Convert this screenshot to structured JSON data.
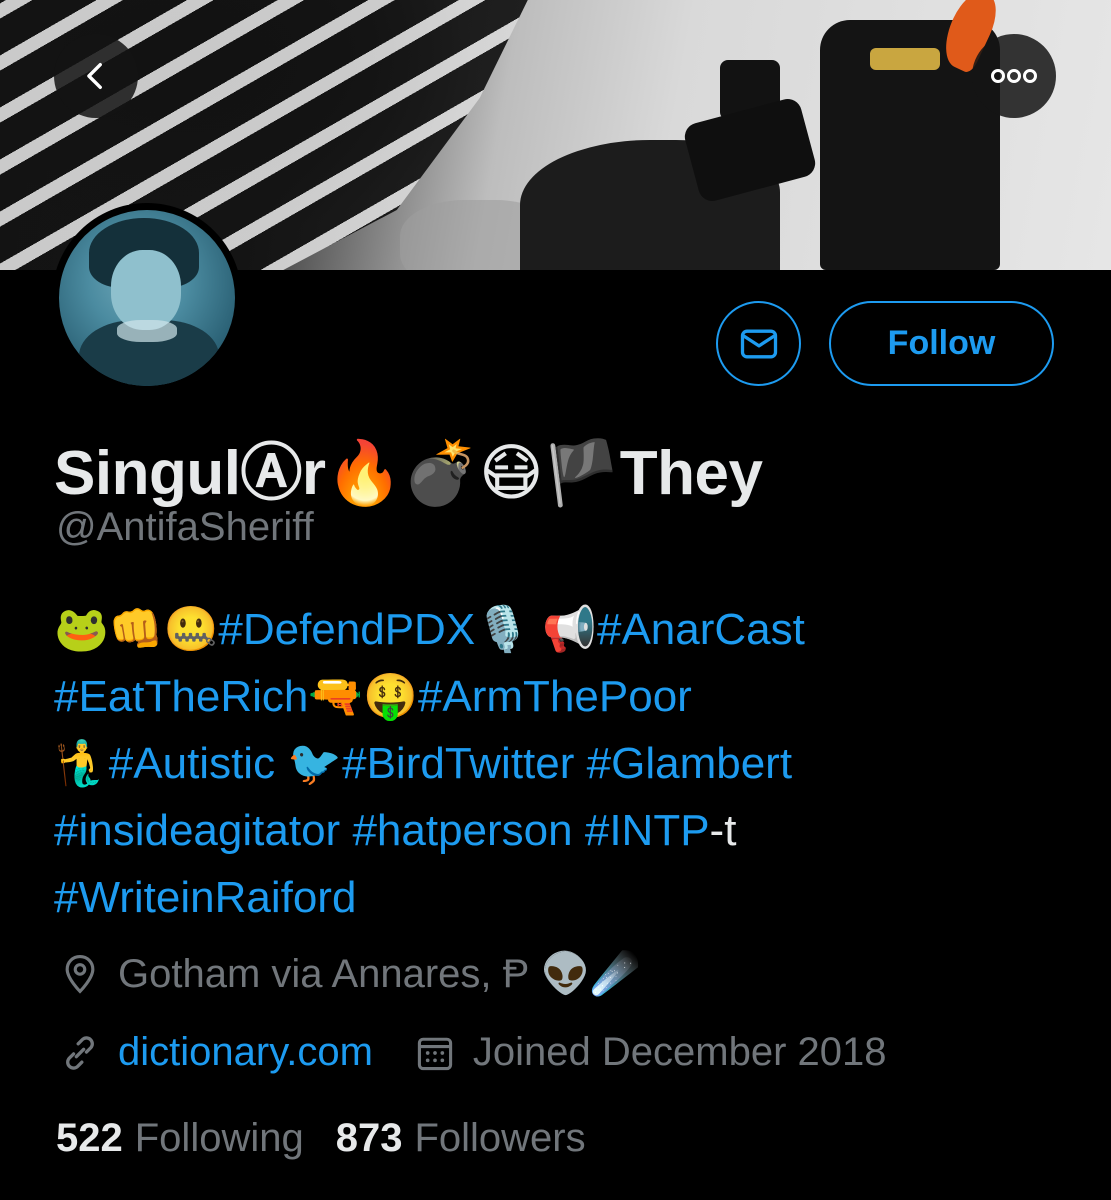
{
  "header": {
    "back_icon": "chevron-left-icon",
    "more_icon": "more-horizontal-icon"
  },
  "profile": {
    "display_name": "SingulⒶr🔥💣😷🏴They",
    "handle": "@AntifaSheriff",
    "follow_label": "Follow",
    "message_icon": "envelope-icon"
  },
  "bio": {
    "lines": [
      [
        {
          "t": "🐸👊🤐",
          "tag": false
        },
        {
          "t": "#DefendPDX",
          "tag": true
        },
        {
          "t": "🎙️ 📢",
          "tag": false
        },
        {
          "t": "#AnarCast",
          "tag": true
        }
      ],
      [
        {
          "t": "#EatTheRich",
          "tag": true
        },
        {
          "t": "🔫🤑",
          "tag": false
        },
        {
          "t": "#ArmThePoor",
          "tag": true
        }
      ],
      [
        {
          "t": "🧜‍♂️",
          "tag": false
        },
        {
          "t": "#Autistic",
          "tag": true
        },
        {
          "t": " 🐦",
          "tag": false
        },
        {
          "t": "#BirdTwitter",
          "tag": true
        },
        {
          "t": " ",
          "tag": false
        },
        {
          "t": "#Glambert",
          "tag": true
        }
      ],
      [
        {
          "t": "#insideagitator",
          "tag": true
        },
        {
          "t": " ",
          "tag": false
        },
        {
          "t": "#hatperson",
          "tag": true
        },
        {
          "t": " ",
          "tag": false
        },
        {
          "t": "#INTP",
          "tag": true
        },
        {
          "t": "-t",
          "tag": false
        }
      ],
      [
        {
          "t": "#WriteinRaiford",
          "tag": true
        }
      ]
    ]
  },
  "meta": {
    "location": "Gotham via Annares, Ᵽ 👽☄️",
    "location_icon": "location-pin-icon",
    "link": "dictionary.com",
    "link_icon": "link-icon",
    "joined": "Joined December 2018",
    "joined_icon": "calendar-icon"
  },
  "stats": {
    "following_count": "522",
    "following_label": "Following",
    "followers_count": "873",
    "followers_label": "Followers"
  },
  "colors": {
    "accent": "#1d9bf0",
    "muted": "#71767b",
    "text": "#e7e9ea",
    "background": "#000000"
  }
}
